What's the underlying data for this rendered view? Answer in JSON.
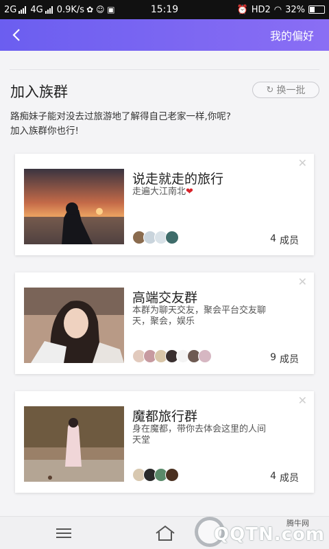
{
  "status_bar": {
    "net1": "2G",
    "net2": "4G",
    "speed": "0.9K/s",
    "time": "15:19",
    "hd": "HD2",
    "battery": "32%"
  },
  "header": {
    "back_icon": "chevron-left-icon",
    "preference_label": "我的偏好"
  },
  "section": {
    "title": "加入族群",
    "refresh_label": "换一批",
    "refresh_icon": "refresh-icon",
    "description_line1": "路痴妹子能对没去过旅游地了解得自己老家一样,你呢?",
    "description_line2": "加入族群你也行!"
  },
  "groups": [
    {
      "title": "说走就走的旅行",
      "subtitle": "走遍大江南北",
      "heart": "❤",
      "member_count": "4",
      "member_label": "成员"
    },
    {
      "title": "高端交友群",
      "subtitle": "本群为聊天交友，聚会平台交友聊天，聚会，娱乐",
      "member_count": "9",
      "member_label": "成员"
    },
    {
      "title": "魔都旅行群",
      "subtitle": "身在魔都，带你去体会这里的人间天堂",
      "member_count": "4",
      "member_label": "成员"
    }
  ],
  "watermark": {
    "text": "QQTN.com",
    "small": "腾牛网"
  },
  "colors": {
    "header_start": "#6b5ef0",
    "header_end": "#8a6ef4",
    "heart": "#d8232a"
  }
}
